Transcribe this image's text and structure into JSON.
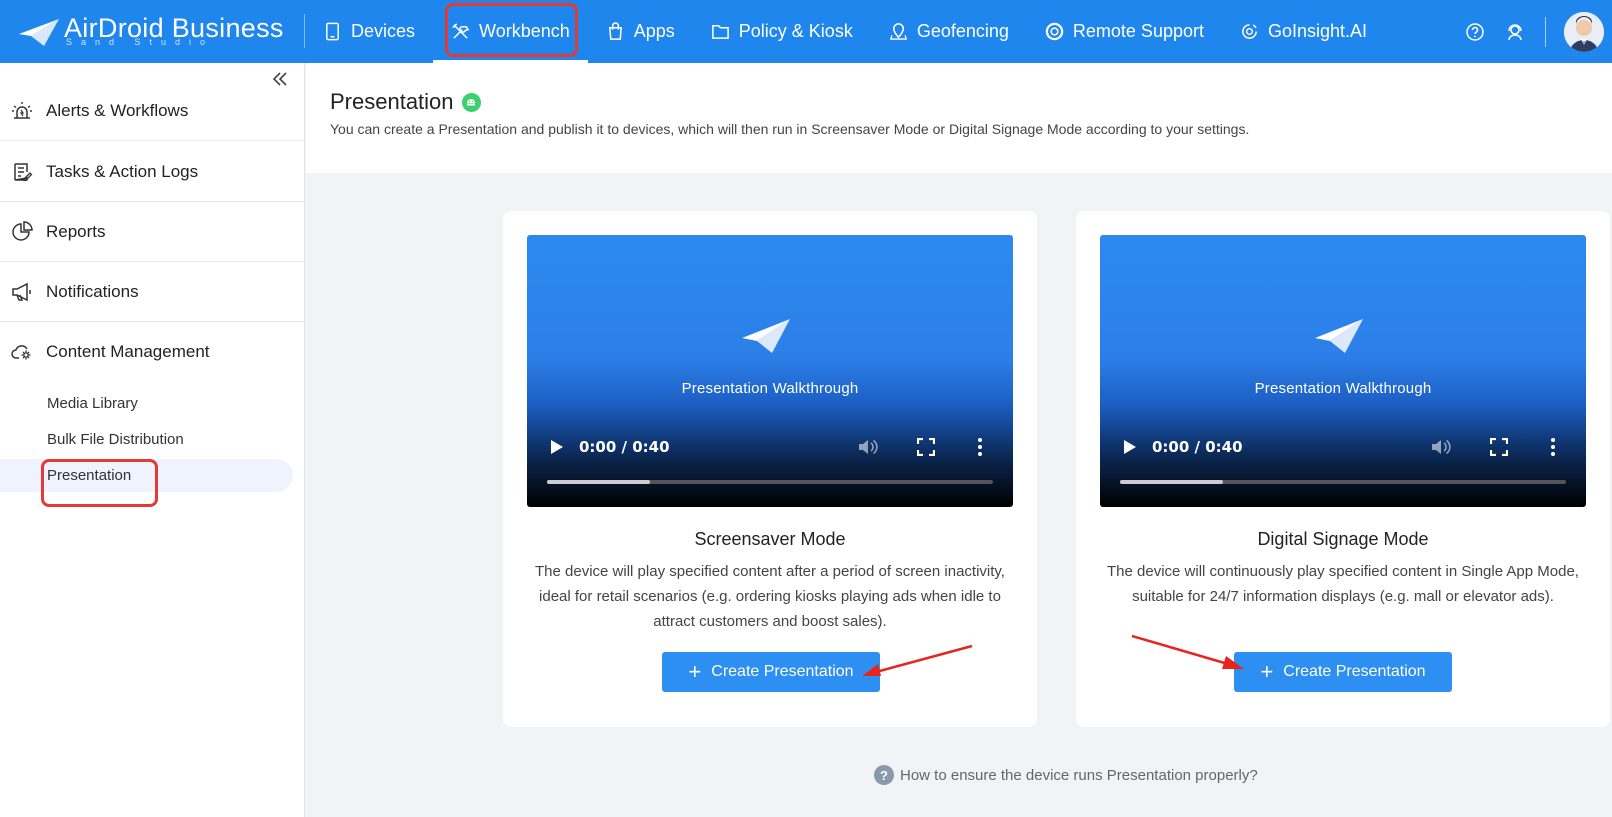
{
  "brand": {
    "name": "AirDroid Business",
    "sub": "Sand Studio"
  },
  "nav": {
    "devices": "Devices",
    "workbench": "Workbench",
    "apps": "Apps",
    "policy": "Policy & Kiosk",
    "geofencing": "Geofencing",
    "remote_support": "Remote Support",
    "goinsight": "GoInsight.AI"
  },
  "sidebar": {
    "items": [
      {
        "label": "Alerts & Workflows",
        "icon": "alarm-icon"
      },
      {
        "label": "Tasks & Action Logs",
        "icon": "task-list-icon"
      },
      {
        "label": "Reports",
        "icon": "pie-chart-icon"
      },
      {
        "label": "Notifications",
        "icon": "megaphone-icon"
      },
      {
        "label": "Content Management",
        "icon": "cloud-gear-icon"
      }
    ],
    "sub_items": [
      "Media Library",
      "Bulk File Distribution",
      "Presentation"
    ]
  },
  "page": {
    "title": "Presentation",
    "description": "You can create a Presentation and publish it to devices, which will then run in Screensaver Mode or Digital Signage Mode according to your settings."
  },
  "cards": [
    {
      "video_title": "Presentation Walkthrough",
      "time": "0:00 / 0:40",
      "progress": 0.23,
      "title": "Screensaver Mode",
      "description": "The device will play specified content after a period of screen inactivity, ideal for retail scenarios (e.g. ordering kiosks playing ads when idle to attract customers and boost sales).",
      "button": "Create Presentation"
    },
    {
      "video_title": "Presentation Walkthrough",
      "time": "0:00 / 0:40",
      "progress": 0.23,
      "title": "Digital Signage Mode",
      "description": "The device will continuously play specified content in Single App Mode, suitable for 24/7 information displays (e.g. mall or elevator ads).",
      "button": "Create Presentation"
    }
  ],
  "help": {
    "text": "How to ensure the device runs Presentation properly?",
    "icon": "?"
  },
  "colors": {
    "brand_blue": "#1f86ee",
    "button_blue": "#2e8ff2",
    "highlight_red": "#e53935",
    "android_green": "#3ccf6e"
  }
}
